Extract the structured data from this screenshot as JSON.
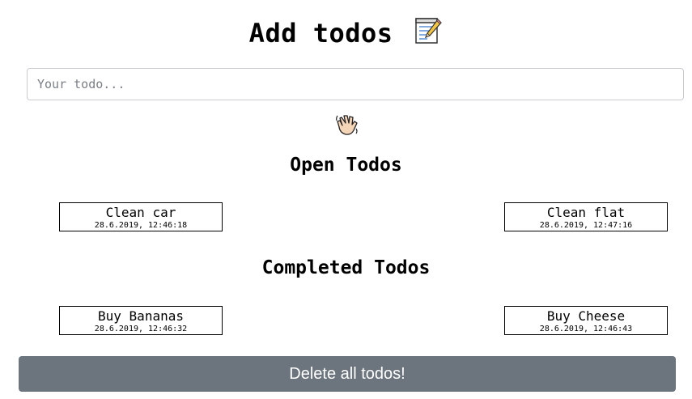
{
  "header": {
    "title": "Add todos",
    "title_icon": "memo-icon"
  },
  "input": {
    "placeholder": "Your todo...",
    "value": ""
  },
  "status_icon": "waving-hand-icon",
  "open_section": {
    "heading": "Open Todos",
    "items": [
      {
        "text": "Clean car",
        "timestamp": "28.6.2019, 12:46:18"
      },
      {
        "text": "Clean flat",
        "timestamp": "28.6.2019, 12:47:16"
      }
    ]
  },
  "completed_section": {
    "heading": "Completed Todos",
    "items": [
      {
        "text": "Buy Bananas",
        "timestamp": "28.6.2019, 12:46:32"
      },
      {
        "text": "Buy Cheese",
        "timestamp": "28.6.2019, 12:46:43"
      }
    ]
  },
  "actions": {
    "delete_all_label": "Delete all todos!"
  },
  "colors": {
    "button_bg": "#6c757d",
    "button_text": "#ffffff",
    "card_border": "#000000",
    "input_border": "#c8cbcf"
  }
}
